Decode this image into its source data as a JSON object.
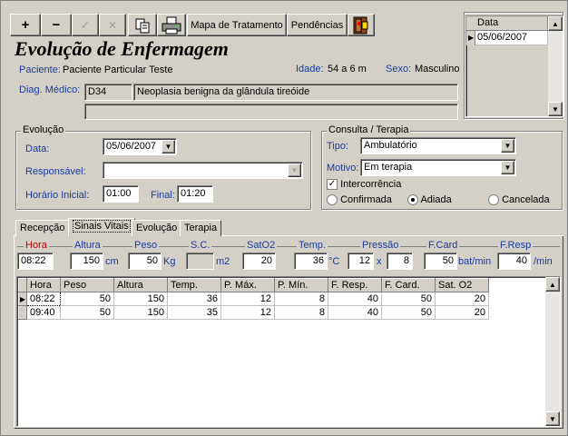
{
  "toolbar": {
    "add_symbol": "+",
    "remove_symbol": "−",
    "confirm_symbol": "✓",
    "cancel_symbol": "✕",
    "mapa_label": "Mapa de Tratamento",
    "pendencias_label": "Pendências"
  },
  "header": {
    "title": "Evolução de Enfermagem",
    "paciente_label": "Paciente:",
    "paciente_value": "Paciente Particular Teste",
    "idade_label": "Idade:",
    "idade_value": "54 a 6 m",
    "sexo_label": "Sexo:",
    "sexo_value": "Masculino",
    "diag_label": "Diag. Médico:",
    "diag_code": "D34",
    "diag_desc": "Neoplasia benigna da glândula tireóide",
    "diag_extra": ""
  },
  "date_list": {
    "header": "Data",
    "items": [
      "05/06/2007"
    ]
  },
  "evolucao": {
    "group_title": "Evolução",
    "data_label": "Data:",
    "data_value": "05/06/2007",
    "responsavel_label": "Responsável:",
    "responsavel_value": "",
    "horario_label": "Horário Inicial:",
    "horario_value": "01:00",
    "final_label": "Final:",
    "final_value": "01:20"
  },
  "consulta": {
    "group_title": "Consulta / Terapia",
    "tipo_label": "Tipo:",
    "tipo_value": "Ambulatório",
    "motivo_label": "Motivo:",
    "motivo_value": "Em terapia",
    "intercorrencia_label": "Intercorrência",
    "intercorrencia_checked": true,
    "radio_confirmada": "Confirmada",
    "radio_adiada": "Adiada",
    "radio_cancelada": "Cancelada",
    "radio_selected": "Adiada"
  },
  "tabs": [
    "Recepção",
    "Sinais Vitais",
    "Evolução",
    "Terapia"
  ],
  "active_tab": "Sinais Vitais",
  "vitals": {
    "hora_label": "Hora",
    "hora_value": "08:22",
    "altura_label": "Altura",
    "altura_value": "150",
    "altura_unit": "cm",
    "peso_label": "Peso",
    "peso_value": "50",
    "peso_unit": "Kg",
    "sc_label": "S.C.",
    "sc_value": "",
    "sc_unit": "m2",
    "sat_label": "SatO2",
    "sat_value": "20",
    "temp_label": "Temp.",
    "temp_value": "36",
    "temp_unit": "°C",
    "pressao_label": "Pressão",
    "pressao_max": "12",
    "pressao_sep": "x",
    "pressao_min": "8",
    "fcard_label": "F.Card",
    "fcard_value": "50",
    "fcard_unit": "bat/min",
    "fresp_label": "F.Resp",
    "fresp_value": "40",
    "fresp_unit": "/min"
  },
  "table": {
    "columns": [
      "Hora",
      "Peso",
      "Altura",
      "Temp.",
      "P. Máx.",
      "P. Mín.",
      "F. Resp.",
      "F. Card.",
      "Sat. O2"
    ],
    "rows": [
      [
        "08:22",
        "50",
        "150",
        "36",
        "12",
        "8",
        "40",
        "50",
        "20"
      ],
      [
        "09:40",
        "50",
        "150",
        "35",
        "12",
        "8",
        "40",
        "50",
        "20"
      ]
    ]
  },
  "colors": {
    "window_bg": "#d4d0c8",
    "label_blue": "#1a3b9c",
    "label_red": "#c00000"
  }
}
